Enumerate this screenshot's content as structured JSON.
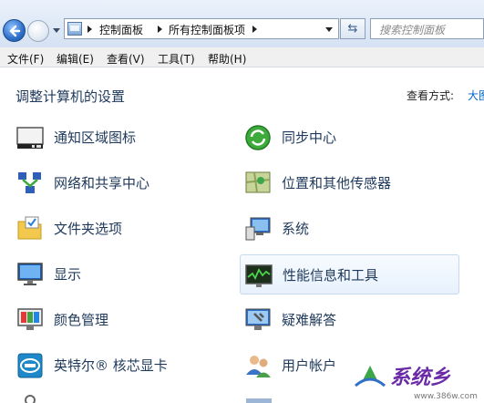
{
  "address_bar": {
    "breadcrumbs": [
      "控制面板",
      "所有控制面板项"
    ],
    "search_placeholder": "搜索控制面板"
  },
  "menu": [
    "文件(F)",
    "编辑(E)",
    "查看(V)",
    "工具(T)",
    "帮助(H)"
  ],
  "content": {
    "title": "调整计算机的设置",
    "view_by_label": "查看方式:",
    "view_by_value": "大图"
  },
  "items_left": [
    {
      "label": "通知区域图标",
      "icon": "notification-area-icon"
    },
    {
      "label": "网络和共享中心",
      "icon": "network-center-icon"
    },
    {
      "label": "文件夹选项",
      "icon": "folder-options-icon"
    },
    {
      "label": "显示",
      "icon": "display-icon"
    },
    {
      "label": "颜色管理",
      "icon": "color-management-icon"
    },
    {
      "label": "英特尔® 核芯显卡",
      "icon": "intel-graphics-icon"
    }
  ],
  "items_right": [
    {
      "label": "同步中心",
      "icon": "sync-center-icon"
    },
    {
      "label": "位置和其他传感器",
      "icon": "location-sensors-icon"
    },
    {
      "label": "系统",
      "icon": "system-icon"
    },
    {
      "label": "性能信息和工具",
      "icon": "performance-icon"
    },
    {
      "label": "疑难解答",
      "icon": "troubleshooting-icon"
    },
    {
      "label": "用户帐户",
      "icon": "user-accounts-icon"
    }
  ],
  "watermark": {
    "text": "系统乡",
    "url": "www.386w.com"
  },
  "colors": {
    "link": "#1e395b",
    "accent": "#0066cc",
    "chrome": "#d5e2f3"
  }
}
